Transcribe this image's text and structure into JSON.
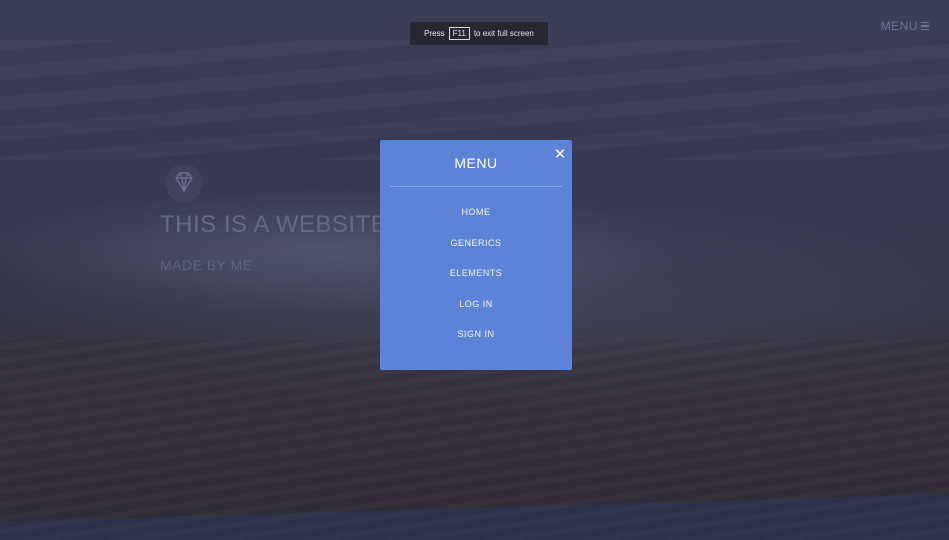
{
  "fullscreen_notice": {
    "prefix": "Press",
    "key": "F11",
    "suffix": "to exit full screen"
  },
  "header": {
    "menu_label": "MENU",
    "menu_icon": "hamburger-icon"
  },
  "hero": {
    "logo_icon": "diamond-icon",
    "title": "THIS IS A WEBSITE",
    "subtitle": "MADE BY ME"
  },
  "menu": {
    "title": "MENU",
    "close_icon": "close-icon",
    "close_glyph": "✕",
    "items": [
      {
        "label": "HOME"
      },
      {
        "label": "GENERICS"
      },
      {
        "label": "ELEMENTS"
      },
      {
        "label": "LOG IN"
      },
      {
        "label": "SIGN IN"
      }
    ]
  },
  "colors": {
    "menu_panel": "#5d83d8",
    "background": "#34364a"
  }
}
